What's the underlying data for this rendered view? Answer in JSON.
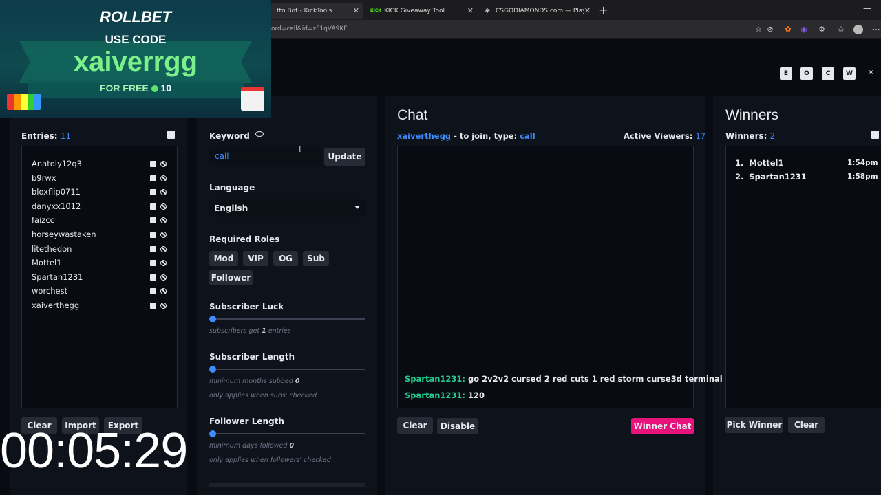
{
  "browser": {
    "tabs": [
      {
        "label": "tto Bot - KickTools",
        "active": true
      },
      {
        "label": "KICK Giveaway Tool",
        "active": false
      },
      {
        "label": "CSGODIAMONDS.com — Play CS:",
        "active": false
      }
    ],
    "url": "ord=call&id=zF1qVA9KF"
  },
  "theme_buttons": [
    "E",
    "O",
    "C",
    "W",
    "☀"
  ],
  "entries_panel": {
    "label": "Entries:",
    "count": "11",
    "entries": [
      "Anatoly12q3",
      "b9rwx",
      "bloxflip0711",
      "danyxx1012",
      "faizcc",
      "horseywastaken",
      "litethedon",
      "Mottel1",
      "Spartan1231",
      "worchest",
      "xaiverthegg"
    ],
    "buttons": {
      "clear": "Clear",
      "import": "Import",
      "export": "Export"
    }
  },
  "options_panel": {
    "keyword_label": "Keyword",
    "keyword_value": "call",
    "update_button": "Update",
    "language_label": "Language",
    "language_value": "English",
    "roles_label": "Required Roles",
    "roles": [
      "Mod",
      "VIP",
      "OG",
      "Sub",
      "Follower"
    ],
    "sub_luck_label": "Subscriber Luck",
    "sub_luck_hint_pre": "subscribers get",
    "sub_luck_hint_val": "1",
    "sub_luck_hint_post": "entries",
    "sub_length_label": "Subscriber Length",
    "sub_length_hint_pre": "minimum months subbed",
    "sub_length_hint_val": "0",
    "sub_length_note": "only applies when subs' checked",
    "follower_length_label": "Follower Length",
    "follower_length_hint_pre": "minimum days followed",
    "follower_length_hint_val": "0",
    "follower_length_note": "only applies when followers' checked"
  },
  "chat_panel": {
    "title": "Chat",
    "channel": "xaiverthegg",
    "join_text": "- to join, type:",
    "keyword": "call",
    "viewers_label": "Active Viewers:",
    "viewers_count": "17",
    "messages": [
      {
        "user": "Spartan1231:",
        "text": "go 2v2v2 cursed 2 red cuts 1 red storm curse3d terminal"
      },
      {
        "user": "Spartan1231:",
        "text": "120"
      }
    ],
    "buttons": {
      "clear": "Clear",
      "disable": "Disable",
      "winner_chat": "Winner Chat"
    }
  },
  "winners_panel": {
    "title": "Winners",
    "label": "Winners:",
    "count": "2",
    "winners": [
      {
        "rank": "1.",
        "name": "Mottel1",
        "time": "1:54pm"
      },
      {
        "rank": "2.",
        "name": "Spartan1231",
        "time": "1:58pm"
      }
    ],
    "buttons": {
      "pick": "Pick Winner",
      "clear": "Clear"
    }
  },
  "promo_overlay": {
    "brand": "ROLLBET",
    "line1": "USE CODE",
    "code": "xaiverrgg",
    "line3": "FOR FREE",
    "amount": "10"
  },
  "timer": "00:05:29",
  "colors": {
    "accent": "#3d8bff",
    "chat_user": "#22c98a",
    "winner_chat": "#e8137a"
  }
}
